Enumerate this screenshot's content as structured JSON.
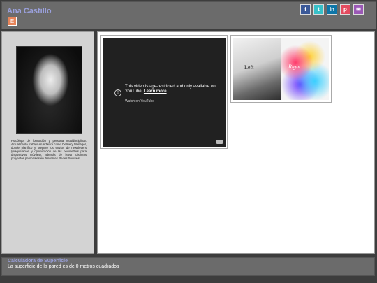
{
  "header": {
    "title": "Ana Castillo",
    "menu_icon": "E"
  },
  "social": [
    {
      "name": "facebook-icon",
      "glyph": "f",
      "color": "#3b5998"
    },
    {
      "name": "twitter-icon",
      "glyph": "t",
      "color": "#38c0c8"
    },
    {
      "name": "linkedin-icon",
      "glyph": "in",
      "color": "#0e76a8"
    },
    {
      "name": "pinterest-icon",
      "glyph": "p",
      "color": "#e44b5f"
    },
    {
      "name": "email-icon",
      "glyph": "✉",
      "color": "#9b59b6"
    }
  ],
  "sidebar": {
    "bio": "Psicóloga de formación y persona multidisciplinar. Actualmente trabajo en Artware como Delivery Manager, donde planifico y preparo los envíos de newsletters (maquetación y optimización de las newsletters para dispositivos móviles), además de llevar distintos proyectos personales en diferentes Redes Sociales."
  },
  "video": {
    "message": "This video is age-restricted and only available on YouTube.",
    "learn_more": "Learn more",
    "watch_link": "Watch on YouTube"
  },
  "art": {
    "left_word": "Left",
    "right_word": "Right"
  },
  "footer": {
    "title": "Calculadora de Superficie",
    "result": "La superficie de la pared es de 0 metros cuadrados"
  },
  "colors": {
    "accent": "#9aa0dc",
    "menu_button": "#e8855a",
    "panel": "#6b6b6b",
    "background": "#3d3d3d"
  }
}
